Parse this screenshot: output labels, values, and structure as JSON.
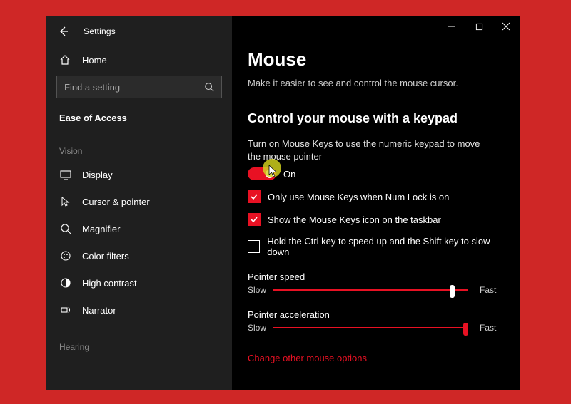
{
  "app": {
    "title": "Settings"
  },
  "sidebar": {
    "home": "Home",
    "search_placeholder": "Find a setting",
    "header": "Ease of Access",
    "groups": [
      {
        "label": "Vision",
        "items": [
          {
            "label": "Display"
          },
          {
            "label": "Cursor & pointer"
          },
          {
            "label": "Magnifier"
          },
          {
            "label": "Color filters"
          },
          {
            "label": "High contrast"
          },
          {
            "label": "Narrator"
          }
        ]
      },
      {
        "label": "Hearing",
        "items": []
      }
    ]
  },
  "page": {
    "title": "Mouse",
    "sub": "Make it easier to see and control the mouse cursor.",
    "section": "Control your mouse with a keypad",
    "toggle_desc": "Turn on Mouse Keys to use the numeric keypad to move the mouse pointer",
    "toggle_state": "On",
    "checks": [
      {
        "label": "Only use Mouse Keys when Num Lock is on",
        "checked": true
      },
      {
        "label": "Show the Mouse Keys icon on the taskbar",
        "checked": true
      },
      {
        "label": "Hold the Ctrl key to speed up and the Shift key to slow down",
        "checked": false
      }
    ],
    "sliders": [
      {
        "label": "Pointer speed",
        "low": "Slow",
        "high": "Fast",
        "value": 0.92,
        "thumb": "white"
      },
      {
        "label": "Pointer acceleration",
        "low": "Slow",
        "high": "Fast",
        "value": 0.99,
        "thumb": "red"
      }
    ],
    "link": "Change other mouse options"
  }
}
